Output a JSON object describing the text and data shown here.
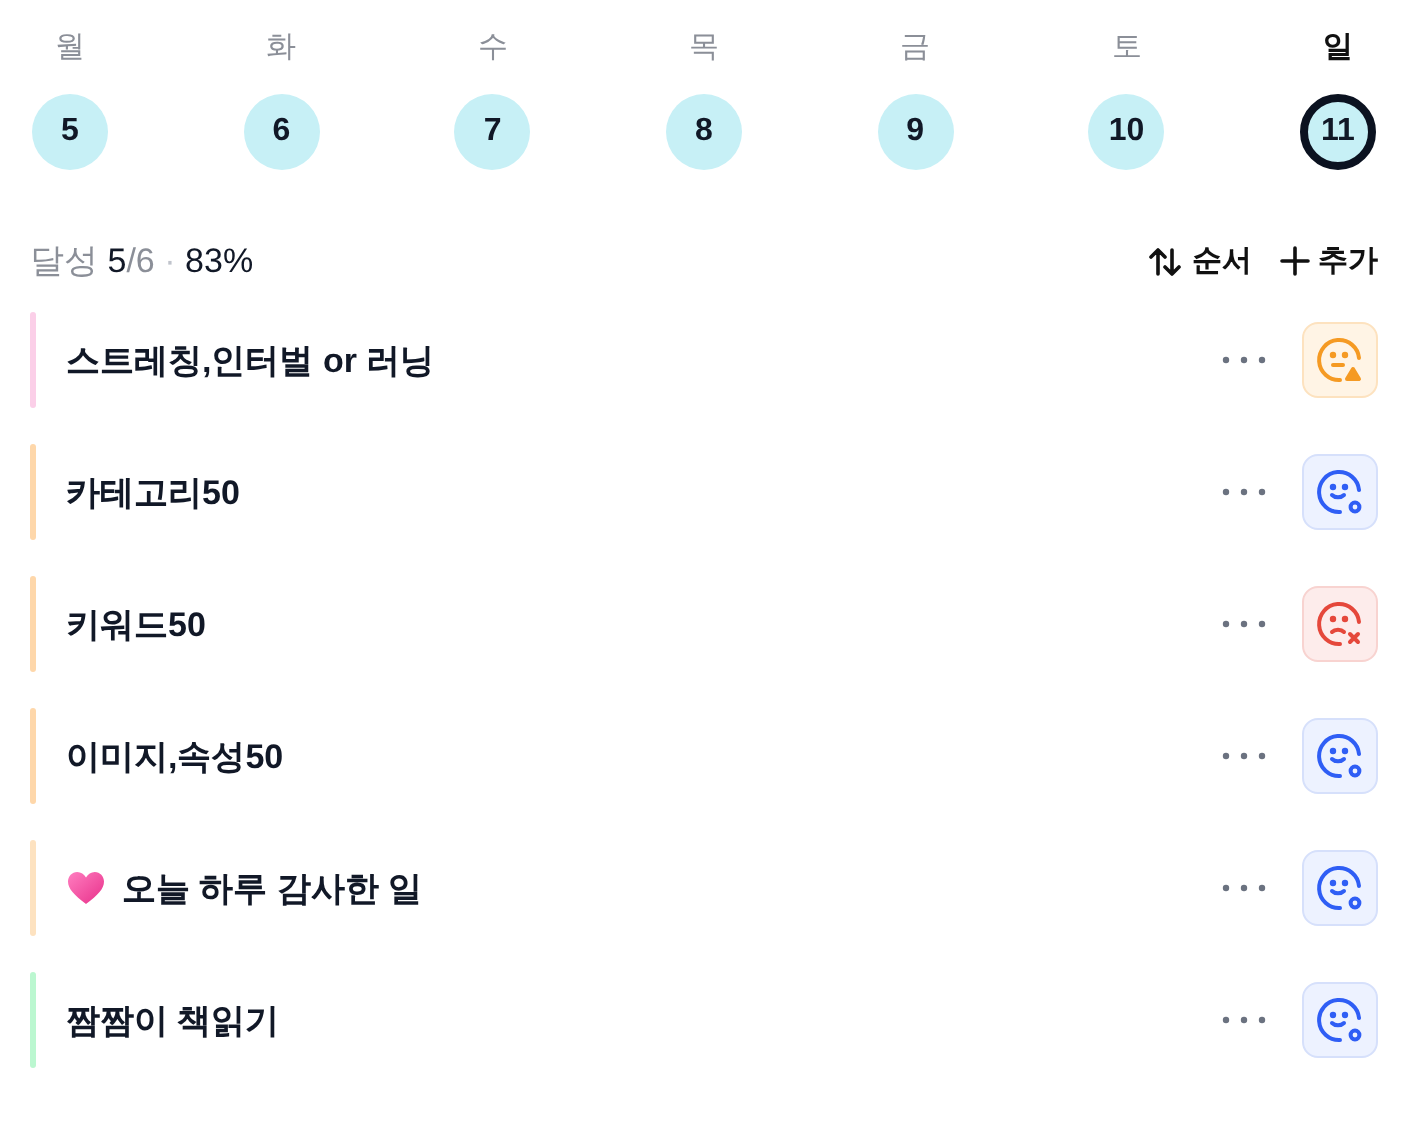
{
  "days": [
    {
      "weekday": "월",
      "date": "5",
      "selected": false
    },
    {
      "weekday": "화",
      "date": "6",
      "selected": false
    },
    {
      "weekday": "수",
      "date": "7",
      "selected": false
    },
    {
      "weekday": "목",
      "date": "8",
      "selected": false
    },
    {
      "weekday": "금",
      "date": "9",
      "selected": false
    },
    {
      "weekday": "토",
      "date": "10",
      "selected": false
    },
    {
      "weekday": "일",
      "date": "11",
      "selected": true
    }
  ],
  "summary": {
    "label": "달성",
    "done": "5",
    "total": "/6",
    "separator": "·",
    "percent": "83%"
  },
  "actions": {
    "sort": "순서",
    "add": "추가"
  },
  "habits": [
    {
      "title": "스트레칭,인터벌 or 러닝",
      "color": "#fbcfe8",
      "heart": false,
      "kind": "partial"
    },
    {
      "title": "카테고리50",
      "color": "#fed7aa",
      "heart": false,
      "kind": "done"
    },
    {
      "title": "키워드50",
      "color": "#fed7aa",
      "heart": false,
      "kind": "failed"
    },
    {
      "title": "이미지,속성50",
      "color": "#fed7aa",
      "heart": false,
      "kind": "done"
    },
    {
      "title": "오늘 하루 감사한 일",
      "color": "#fde2c0",
      "heart": true,
      "kind": "done"
    },
    {
      "title": "짬짬이 책읽기",
      "color": "#bbf7d0",
      "heart": false,
      "kind": "done"
    }
  ]
}
